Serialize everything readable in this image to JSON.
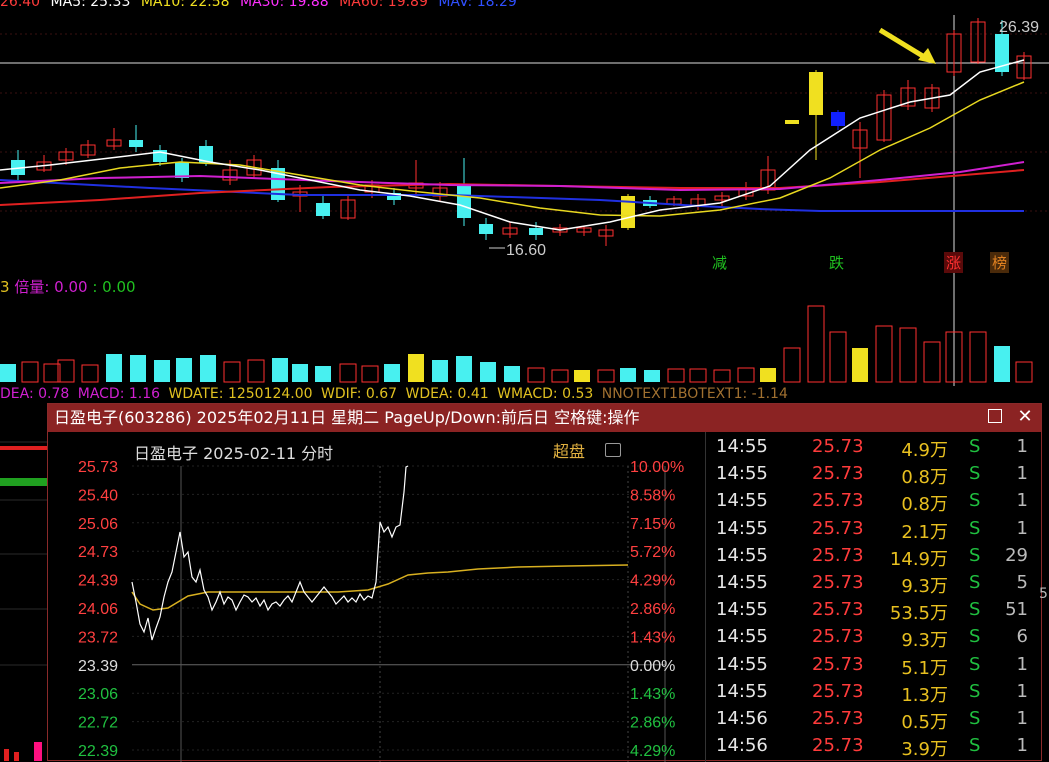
{
  "indicator_row": {
    "prefix": "26.40",
    "ma5": "MA5: 25.33",
    "ma10": "MA10: 22.58",
    "ma30": "MA30: 19.88",
    "ma60": "MA60: 19.89",
    "mav": "MAV: 18.29",
    "colors": {
      "prefix": "#ff3b3b",
      "ma5": "#ffffff",
      "ma10": "#f0e020",
      "ma30": "#ff30ff",
      "ma60": "#ff3b3b",
      "mav": "#3050ff"
    }
  },
  "price_labels": {
    "high": "26.39",
    "low": "16.60"
  },
  "signal_badges": [
    {
      "text": "减",
      "color": "#20c020"
    },
    {
      "text": "跌",
      "color": "#20c020"
    },
    {
      "text": "涨",
      "color": "#ff3030"
    },
    {
      "text": "榜",
      "color": "#e08020"
    }
  ],
  "volume_header": {
    "prefix": "3",
    "label": "倍量: 0.00",
    "value": ": 0.00"
  },
  "macd_bar": {
    "dea": "DEA: 0.78",
    "macd": "MACD: 1.16",
    "wdate": "WDATE: 1250124.00",
    "wdif": "WDIF: 0.67",
    "wdea": "WDEA: 0.41",
    "wmacd": "WMACD: 0.53",
    "nnotext": "NNOTEXT1BOTEXT1: -1.14"
  },
  "popup": {
    "title": "日盈电子(603286) 2025年02月11日 星期二 PageUp/Down:前后日 空格键:操作",
    "maximize_icon": "maximize-icon",
    "close_icon": "close-icon",
    "close_glyph": "✕",
    "intraday_header": "日盈电子   2025-02-11 分时",
    "super_label": "超盘",
    "price_ticks": [
      "25.73",
      "25.40",
      "25.06",
      "24.73",
      "24.39",
      "24.06",
      "23.72",
      "23.39",
      "23.06",
      "22.72",
      "22.39"
    ],
    "pct_ticks": [
      "10.00%",
      "8.58%",
      "7.15%",
      "5.72%",
      "4.29%",
      "2.86%",
      "1.43%",
      "0.00%",
      "1.43%",
      "2.86%",
      "4.29%"
    ],
    "ticks": [
      {
        "time": "14:55",
        "price": "25.73",
        "vol": "4.9万",
        "side": "S",
        "count": "1"
      },
      {
        "time": "14:55",
        "price": "25.73",
        "vol": "0.8万",
        "side": "S",
        "count": "1"
      },
      {
        "time": "14:55",
        "price": "25.73",
        "vol": "0.8万",
        "side": "S",
        "count": "1"
      },
      {
        "time": "14:55",
        "price": "25.73",
        "vol": "2.1万",
        "side": "S",
        "count": "1"
      },
      {
        "time": "14:55",
        "price": "25.73",
        "vol": "14.9万",
        "side": "S",
        "count": "29"
      },
      {
        "time": "14:55",
        "price": "25.73",
        "vol": "9.3万",
        "side": "S",
        "count": "5"
      },
      {
        "time": "14:55",
        "price": "25.73",
        "vol": "53.5万",
        "side": "S",
        "count": "51"
      },
      {
        "time": "14:55",
        "price": "25.73",
        "vol": "9.3万",
        "side": "S",
        "count": "6"
      },
      {
        "time": "14:55",
        "price": "25.73",
        "vol": "5.1万",
        "side": "S",
        "count": "1"
      },
      {
        "time": "14:55",
        "price": "25.73",
        "vol": "1.3万",
        "side": "S",
        "count": "1"
      },
      {
        "time": "14:56",
        "price": "25.73",
        "vol": "0.5万",
        "side": "S",
        "count": "1"
      },
      {
        "time": "14:56",
        "price": "25.73",
        "vol": "3.9万",
        "side": "S",
        "count": "1"
      }
    ],
    "side_edge_digit": "5"
  }
}
